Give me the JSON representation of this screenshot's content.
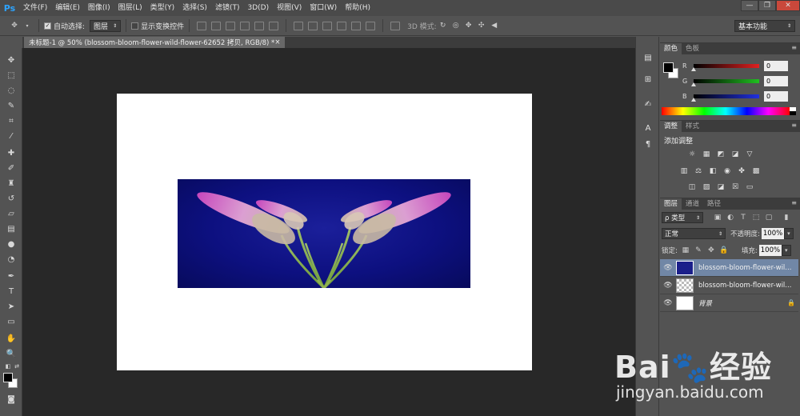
{
  "app": {
    "logo": "Ps"
  },
  "menu": [
    "文件(F)",
    "编辑(E)",
    "图像(I)",
    "图层(L)",
    "类型(Y)",
    "选择(S)",
    "滤镜(T)",
    "3D(D)",
    "视图(V)",
    "窗口(W)",
    "帮助(H)"
  ],
  "window_controls": {
    "minimize": "—",
    "restore": "❐",
    "close": "✕"
  },
  "options": {
    "auto_select_label": "自动选择:",
    "auto_select_checked": true,
    "auto_select_target": "图层",
    "show_transform_label": "显示变换控件",
    "show_transform_checked": false,
    "mode_3d_label": "3D 模式:",
    "workspace": "基本功能"
  },
  "document_tab": {
    "title": "未标题-1 @ 50% (blossom-bloom-flower-wild-flower-62652 拷贝, RGB/8) *",
    "close": "×"
  },
  "color_panel": {
    "tabs": [
      "颜色",
      "色板"
    ],
    "channels": [
      {
        "name": "R",
        "value": "0",
        "color": "#e02020"
      },
      {
        "name": "G",
        "value": "0",
        "color": "#20c020"
      },
      {
        "name": "B",
        "value": "0",
        "color": "#2030e0"
      }
    ]
  },
  "adjust_panel": {
    "tabs": [
      "调整",
      "样式"
    ],
    "title": "添加调整"
  },
  "layers_panel": {
    "tabs": [
      "图层",
      "通道",
      "路径"
    ],
    "filter_label": "ρ 类型",
    "blend_mode": "正常",
    "opacity_label": "不透明度:",
    "opacity": "100%",
    "lock_label": "锁定:",
    "fill_label": "填充:",
    "fill": "100%",
    "layers": [
      {
        "name": "blossom-bloom-flower-wil...",
        "selected": true
      },
      {
        "name": "blossom-bloom-flower-wil...",
        "selected": false
      },
      {
        "name": "背景",
        "selected": false
      }
    ]
  },
  "watermark": {
    "logo": "Bai🐾经验",
    "url": "jingyan.baidu.com"
  }
}
